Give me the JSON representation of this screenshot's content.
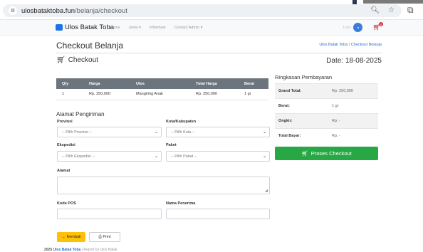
{
  "browser": {
    "url_host": "ulosbataktoba.fun",
    "url_path": "/belanja/checkout"
  },
  "navbar": {
    "brand": "Ulos Batak Toba",
    "links": [
      "Home",
      "Jenis ▾",
      "Informasi",
      "Contact Admin ▾"
    ],
    "user_label": "Lolo",
    "cart_count": "0"
  },
  "page": {
    "title": "Checkout Belanja",
    "breadcrumb_home": "Ulos Batak Toba",
    "breadcrumb_sep": "/",
    "breadcrumb_current": "Checkout Belanja",
    "checkout_heading": "Checkout",
    "date": "Date: 18-08-2025"
  },
  "items_table": {
    "headers": [
      "Qty",
      "Harga",
      "Ulos",
      "Total Harga",
      "Berat"
    ],
    "rows": [
      [
        "1",
        "Rp. 250,000",
        "Mangiring Anak",
        "Rp. 250,000",
        "1 gr"
      ]
    ]
  },
  "shipping": {
    "title": "Alamat Pengiriman",
    "provinsi_label": "Provinsi",
    "provinsi_value": "-- Pilih Provinsi --",
    "kota_label": "Kota/Kabupaten",
    "kota_value": "-- Pilih Kota --",
    "ekspedisi_label": "Ekspedisi",
    "ekspedisi_value": "-- Pilih Ekspedisi --",
    "paket_label": "Paket",
    "paket_value": "-- Pilih Paket --",
    "alamat_label": "Alamat",
    "kodepos_label": "Kode POS",
    "penerima_label": "Nama Penerima"
  },
  "summary": {
    "title": "Ringkasan Pembayaran",
    "rows": [
      {
        "key": "Grand Total:",
        "value": "Rp. 250,000"
      },
      {
        "key": "Berat:",
        "value": "1 gr"
      },
      {
        "key": "Ongkir:",
        "value": "Rp. -"
      },
      {
        "key": "Total Bayar:",
        "value": "Rp. -"
      }
    ],
    "checkout_button": "Proses Checkout"
  },
  "actions": {
    "back_label": "Kembali",
    "print_label": "Print"
  },
  "footer": {
    "year": "2025",
    "brand": "Ulos Batak Toba",
    "rest": "| Report by Ulos Batak"
  },
  "colors": {
    "accent": "#1a73e8",
    "success": "#28a745",
    "warning": "#ffc107",
    "table_header": "#6c757d"
  }
}
